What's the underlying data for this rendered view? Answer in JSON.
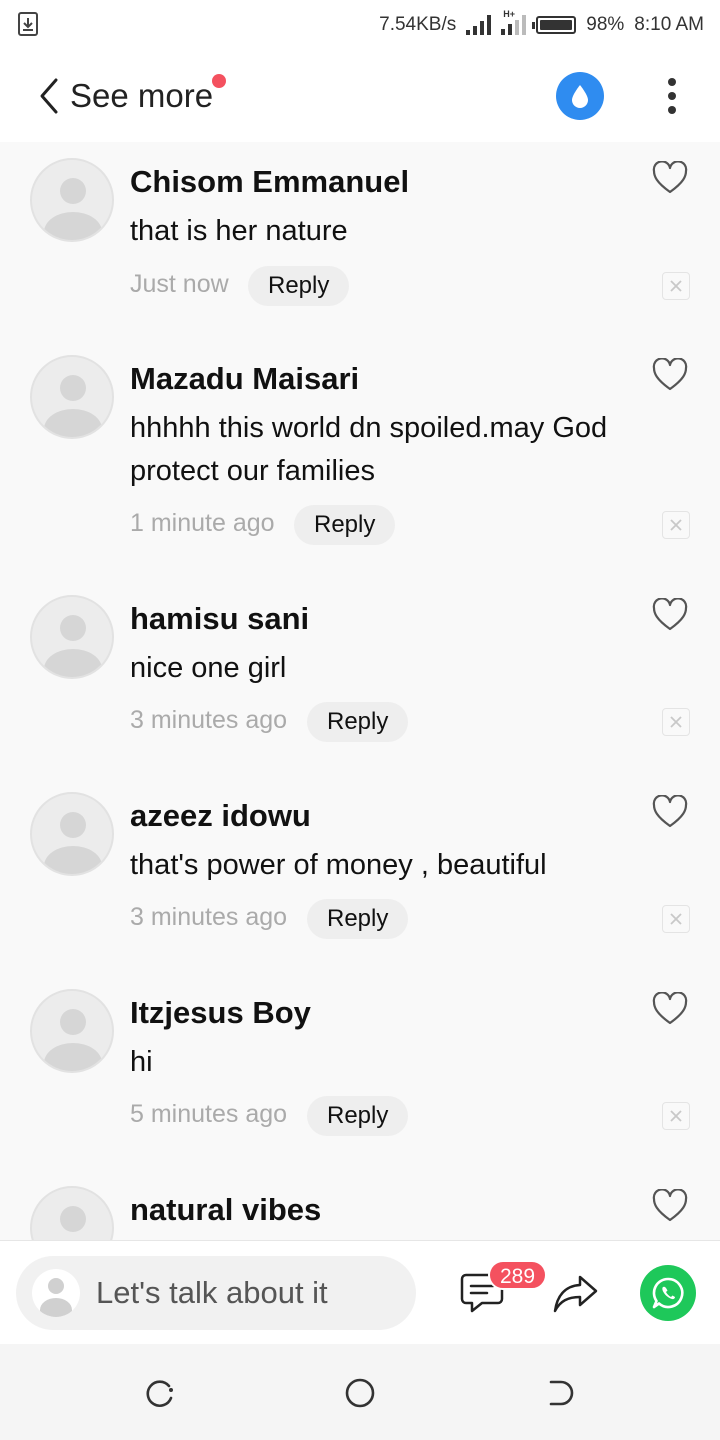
{
  "status_bar": {
    "speed": "7.54KB/s",
    "battery": "98%",
    "time": "8:10 AM",
    "network_label": "H+"
  },
  "header": {
    "back_label": "See more",
    "back_icon": "chevron-left-icon",
    "drop_icon": "water-drop-icon",
    "more_icon": "more-vertical-icon",
    "accent_color": "#2f8cf0",
    "dot_color": "#f4515f"
  },
  "comments": [
    {
      "name": "Chisom Emmanuel",
      "text": "that is her nature",
      "time": "Just now",
      "reply": "Reply"
    },
    {
      "name": "Mazadu Maisari",
      "text": "hhhhh this world dn spoiled.may God protect our families",
      "time": "1 minute ago",
      "reply": "Reply"
    },
    {
      "name": "hamisu sani",
      "text": "nice one girl",
      "time": "3 minutes ago",
      "reply": "Reply"
    },
    {
      "name": "azeez idowu",
      "text": "that's power of money , beautiful",
      "time": "3 minutes ago",
      "reply": "Reply"
    },
    {
      "name": "Itzjesus Boy",
      "text": "hi",
      "time": "5 minutes ago",
      "reply": "Reply"
    },
    {
      "name": "natural vibes"
    }
  ],
  "bottom_bar": {
    "input_placeholder": "Let's talk about it",
    "comment_count": "289",
    "badge_color": "#f4515f",
    "whatsapp_color": "#1ec85a"
  }
}
